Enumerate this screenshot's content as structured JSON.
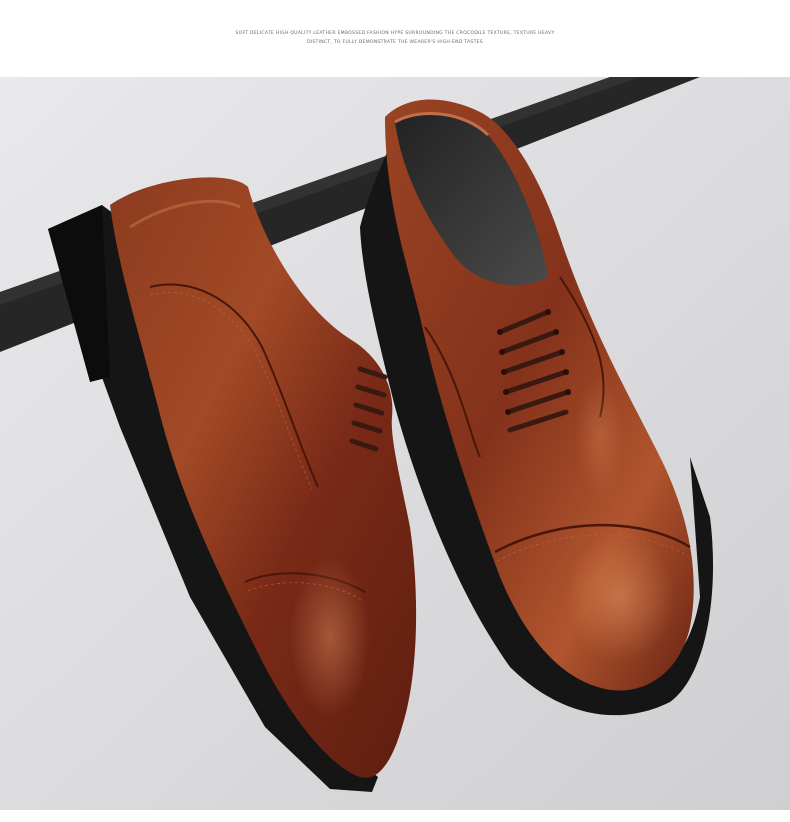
{
  "caption": {
    "line1": "SOFT DELICATE HIGH QUALITY LEATHER EMBOSSED FASHION HYPE SURROUNDING THE CROCODILE TEXTURE, TEXTURE HEAVY",
    "line2": "DISTINCT, TO FULLY DEMONSTRATE  THE WEARER'S HIGH-END TASTES"
  },
  "photo": {
    "subject": "pair of brown leather cap-toe oxford shoes",
    "colors": {
      "background": "#dcdcde",
      "leather": "#7a2a17",
      "leather_highlight": "#b0552e",
      "sole": "#151515",
      "bar": "#262626",
      "lining": "#3a3a3a"
    }
  }
}
